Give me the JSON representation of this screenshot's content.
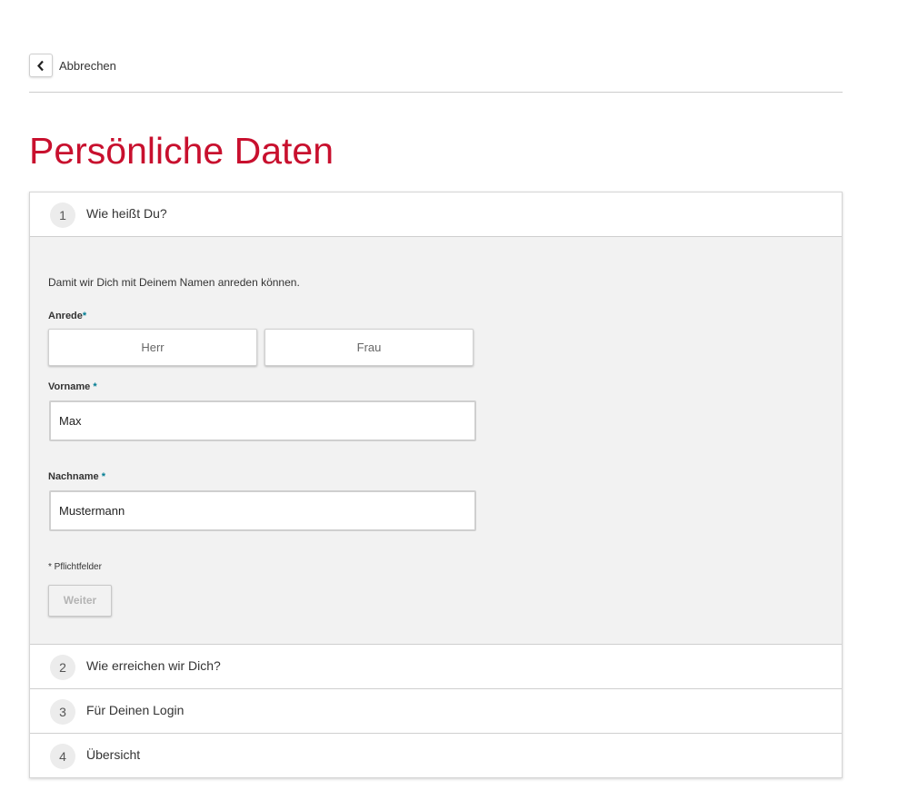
{
  "header": {
    "back_label": "Abbrechen"
  },
  "page": {
    "title": "Persönliche Daten"
  },
  "steps": [
    {
      "number": "1",
      "title": "Wie heißt Du?"
    },
    {
      "number": "2",
      "title": "Wie erreichen wir Dich?"
    },
    {
      "number": "3",
      "title": "Für Deinen Login"
    },
    {
      "number": "4",
      "title": "Übersicht"
    }
  ],
  "form": {
    "intro": "Damit wir Dich mit Deinem Namen anreden können.",
    "salutation": {
      "label": "Anrede",
      "options": [
        "Herr",
        "Frau"
      ]
    },
    "firstname": {
      "label": "Vorname ",
      "value": "Max"
    },
    "lastname": {
      "label": "Nachname ",
      "value": "Mustermann"
    },
    "required_marker": "*",
    "required_note": "* Pflichtfelder",
    "next_label": "Weiter"
  },
  "colors": {
    "brand_red": "#c8102e",
    "required_teal": "#007c92"
  }
}
